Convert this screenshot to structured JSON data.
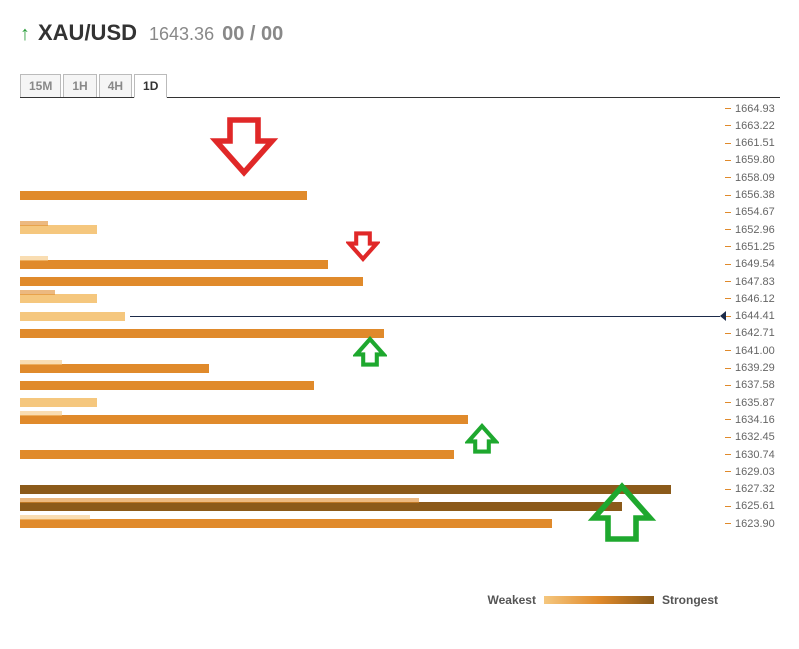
{
  "header": {
    "direction_icon": "↑",
    "pair": "XAU/USD",
    "price": "1643.36",
    "ratio": "00 / 00"
  },
  "tabs": [
    {
      "label": "15M",
      "active": false
    },
    {
      "label": "1H",
      "active": false
    },
    {
      "label": "4H",
      "active": false
    },
    {
      "label": "1D",
      "active": true
    }
  ],
  "legend": {
    "weak": "Weakest",
    "strong": "Strongest"
  },
  "colors": {
    "weak": "#f5c77e",
    "mid": "#e08a2b",
    "strong": "#8b5a1a"
  },
  "chart_data": {
    "type": "bar",
    "title": "",
    "xlabel": "",
    "ylabel": "",
    "x_range_pct": [
      0,
      100
    ],
    "levels": [
      {
        "price": 1664.93,
        "strength": 0,
        "color": "mid"
      },
      {
        "price": 1663.22,
        "strength": 0,
        "color": "mid"
      },
      {
        "price": 1661.51,
        "strength": 0,
        "color": "mid"
      },
      {
        "price": 1659.8,
        "strength": 0,
        "color": "mid"
      },
      {
        "price": 1658.09,
        "strength": 0,
        "color": "mid"
      },
      {
        "price": 1656.38,
        "strength": 41,
        "color": "mid"
      },
      {
        "price": 1654.67,
        "strength": 0,
        "color": "mid"
      },
      {
        "price": 1652.96,
        "strength": 11,
        "color": "weak",
        "sub": {
          "strength": 4,
          "color": "mid"
        }
      },
      {
        "price": 1651.25,
        "strength": 0,
        "color": "mid"
      },
      {
        "price": 1649.54,
        "strength": 44,
        "color": "mid",
        "sub": {
          "strength": 4,
          "color": "weak"
        }
      },
      {
        "price": 1647.83,
        "strength": 49,
        "color": "mid"
      },
      {
        "price": 1646.12,
        "strength": 11,
        "color": "weak",
        "sub": {
          "strength": 5,
          "color": "mid"
        }
      },
      {
        "price": 1644.41,
        "strength": 15,
        "color": "weak",
        "current": true
      },
      {
        "price": 1642.71,
        "strength": 52,
        "color": "mid"
      },
      {
        "price": 1641.0,
        "strength": 0,
        "color": "mid"
      },
      {
        "price": 1639.29,
        "strength": 27,
        "color": "mid",
        "sub": {
          "strength": 6,
          "color": "weak"
        }
      },
      {
        "price": 1637.58,
        "strength": 42,
        "color": "mid"
      },
      {
        "price": 1635.87,
        "strength": 11,
        "color": "weak"
      },
      {
        "price": 1634.16,
        "strength": 64,
        "color": "mid",
        "sub": {
          "strength": 6,
          "color": "weak"
        }
      },
      {
        "price": 1632.45,
        "strength": 0,
        "color": "mid"
      },
      {
        "price": 1630.74,
        "strength": 62,
        "color": "mid"
      },
      {
        "price": 1629.03,
        "strength": 0,
        "color": "mid"
      },
      {
        "price": 1627.32,
        "strength": 93,
        "color": "strong"
      },
      {
        "price": 1625.61,
        "strength": 86,
        "color": "strong",
        "sub": {
          "strength": 57,
          "color": "mid"
        }
      },
      {
        "price": 1623.9,
        "strength": 76,
        "color": "mid",
        "sub": {
          "strength": 10,
          "color": "weak"
        }
      }
    ],
    "annotations": [
      {
        "kind": "down",
        "color": "red",
        "size": "large",
        "x_pct": 32,
        "row": 2
      },
      {
        "kind": "down",
        "color": "red",
        "size": "small",
        "x_pct": 49,
        "row": 8
      },
      {
        "kind": "up",
        "color": "green",
        "size": "small",
        "x_pct": 50,
        "row": 14
      },
      {
        "kind": "up",
        "color": "green",
        "size": "small",
        "x_pct": 66,
        "row": 19
      },
      {
        "kind": "up",
        "color": "green",
        "size": "large",
        "x_pct": 86,
        "row": 23
      }
    ]
  }
}
